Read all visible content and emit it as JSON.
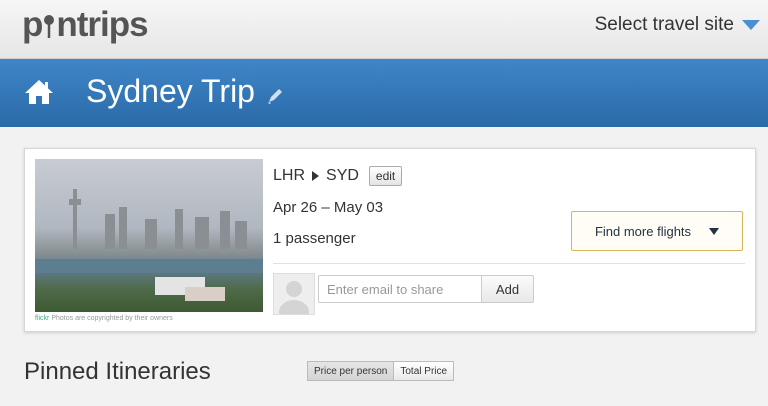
{
  "brand": {
    "logo_text_p": "p",
    "logo_text_rest": "ntrips"
  },
  "site_select": {
    "label": "Select travel site"
  },
  "header": {
    "title": "Sydney Trip",
    "bg_color": "#3478bb"
  },
  "trip_card": {
    "route_from": "LHR",
    "route_to": "SYD",
    "edit_label": "edit",
    "dates": "Apr 26 – May 03",
    "passengers": "1 passenger",
    "find_flights_label": "Find more flights",
    "photo_credit_source": "flickr",
    "photo_credit_text": "Photos are copyrighted by their owners",
    "share": {
      "placeholder": "Enter email to share",
      "add_label": "Add"
    }
  },
  "pinned": {
    "title": "Pinned Itineraries",
    "toggle": [
      {
        "label": "Price per person",
        "active": true
      },
      {
        "label": "Total Price",
        "active": false
      }
    ]
  }
}
